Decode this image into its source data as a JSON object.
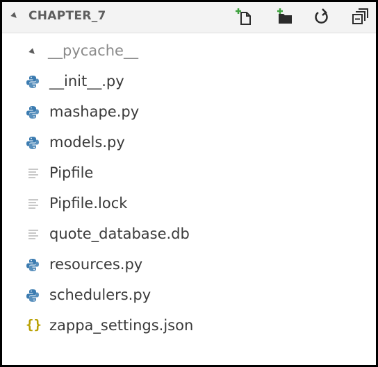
{
  "explorer": {
    "title": "CHAPTER_7",
    "toolbar": [
      {
        "name": "new-file-icon"
      },
      {
        "name": "new-folder-icon"
      },
      {
        "name": "refresh-icon"
      },
      {
        "name": "collapse-all-icon"
      }
    ]
  },
  "tree": {
    "items": [
      {
        "label": "__pycache__",
        "type": "folder",
        "icon": "chevron-down-icon"
      },
      {
        "label": "__init__.py",
        "type": "python",
        "icon": "python-icon"
      },
      {
        "label": "mashape.py",
        "type": "python",
        "icon": "python-icon"
      },
      {
        "label": "models.py",
        "type": "python",
        "icon": "python-icon"
      },
      {
        "label": "Pipfile",
        "type": "text",
        "icon": "text-file-icon"
      },
      {
        "label": "Pipfile.lock",
        "type": "text",
        "icon": "text-file-icon"
      },
      {
        "label": "quote_database.db",
        "type": "text",
        "icon": "text-file-icon"
      },
      {
        "label": "resources.py",
        "type": "python",
        "icon": "python-icon"
      },
      {
        "label": "schedulers.py",
        "type": "python",
        "icon": "python-icon"
      },
      {
        "label": "zappa_settings.json",
        "type": "json",
        "icon": "json-icon",
        "icon_glyph": "{}"
      }
    ]
  },
  "colors": {
    "python_blue": "#3b7bb0",
    "json_yellow": "#b8a000",
    "text_dark": "#3a3a3a",
    "text_muted": "#8a8a8a",
    "icon_grey": "#5c5c5c"
  }
}
